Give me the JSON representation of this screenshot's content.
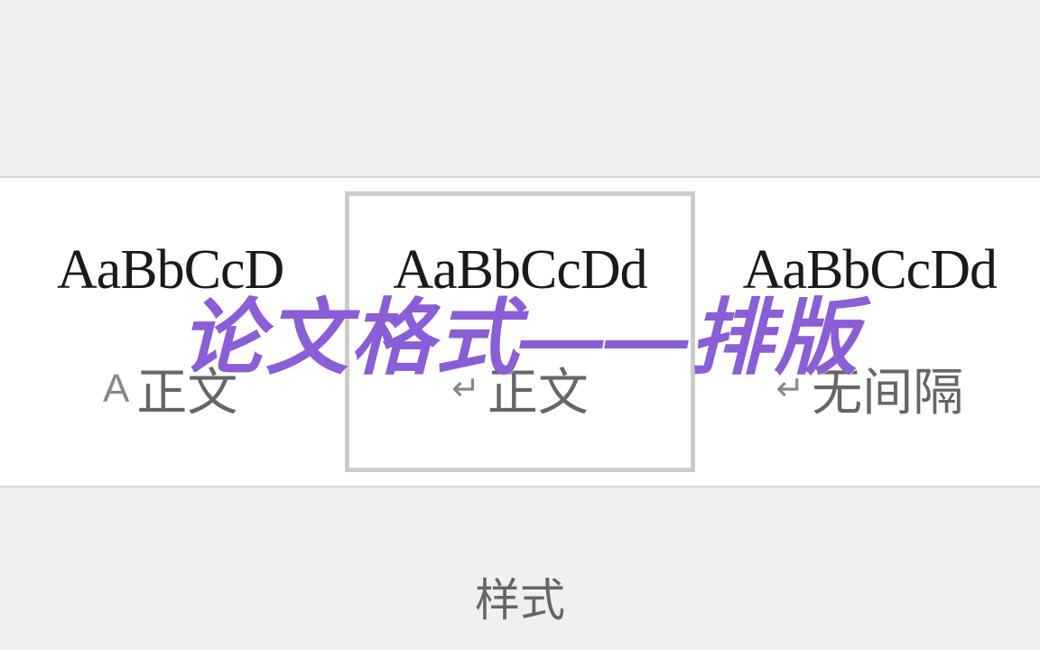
{
  "styles": {
    "group_label": "样式",
    "items": [
      {
        "sample": "AaBbCcD",
        "prefix": "A",
        "label": "正文"
      },
      {
        "sample": "AaBbCcDd",
        "prefix": "↵",
        "label": "正文"
      },
      {
        "sample": "AaBbCcDd",
        "prefix": "↵",
        "label": "无间隔"
      }
    ]
  },
  "overlay": {
    "title": "论文格式——排版"
  }
}
